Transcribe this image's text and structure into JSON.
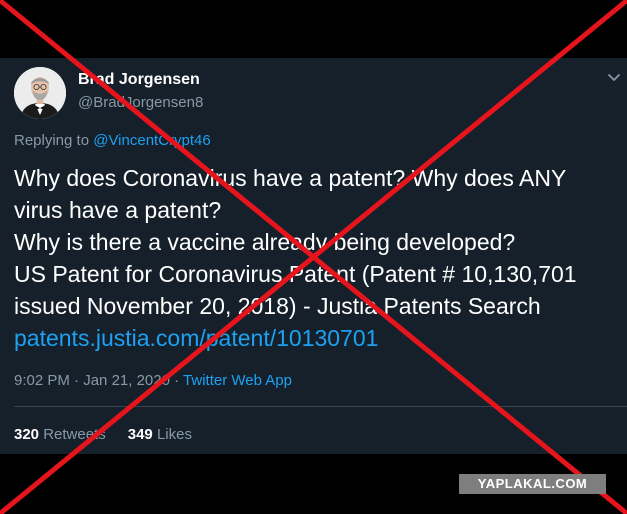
{
  "tweet": {
    "author_name": "Brad Jorgensen",
    "author_handle": "@BradJorgensen8",
    "replying_prefix": "Replying to",
    "replying_to": "@VincentCrypt46",
    "body_lines": [
      "Why does Coronavirus have a patent? Why does ANY",
      "virus have a patent?",
      "Why is there a vaccine already being developed?",
      "US Patent for Coronavirus Patent (Patent # 10,130,701",
      "issued November 20, 2018) - Justia Patents Search"
    ],
    "link_text": "patents.justia.com/patent/10130701",
    "time": "9:02 PM",
    "date_separator": "·",
    "date": "Jan 21, 2020",
    "source_separator": "·",
    "source": "Twitter Web App",
    "retweets_count": "320",
    "retweets_label": "Retweets",
    "likes_count": "349",
    "likes_label": "Likes"
  },
  "watermark": "YAPLAKAL.COM",
  "icons": {
    "menu": "chevron-down-icon",
    "avatar": "profile-photo"
  },
  "colors": {
    "card_background": "#15202b",
    "page_background": "#000000",
    "link_blue": "#1da1f2",
    "secondary_text": "#8899a6",
    "cross_red": "#e6141c"
  }
}
